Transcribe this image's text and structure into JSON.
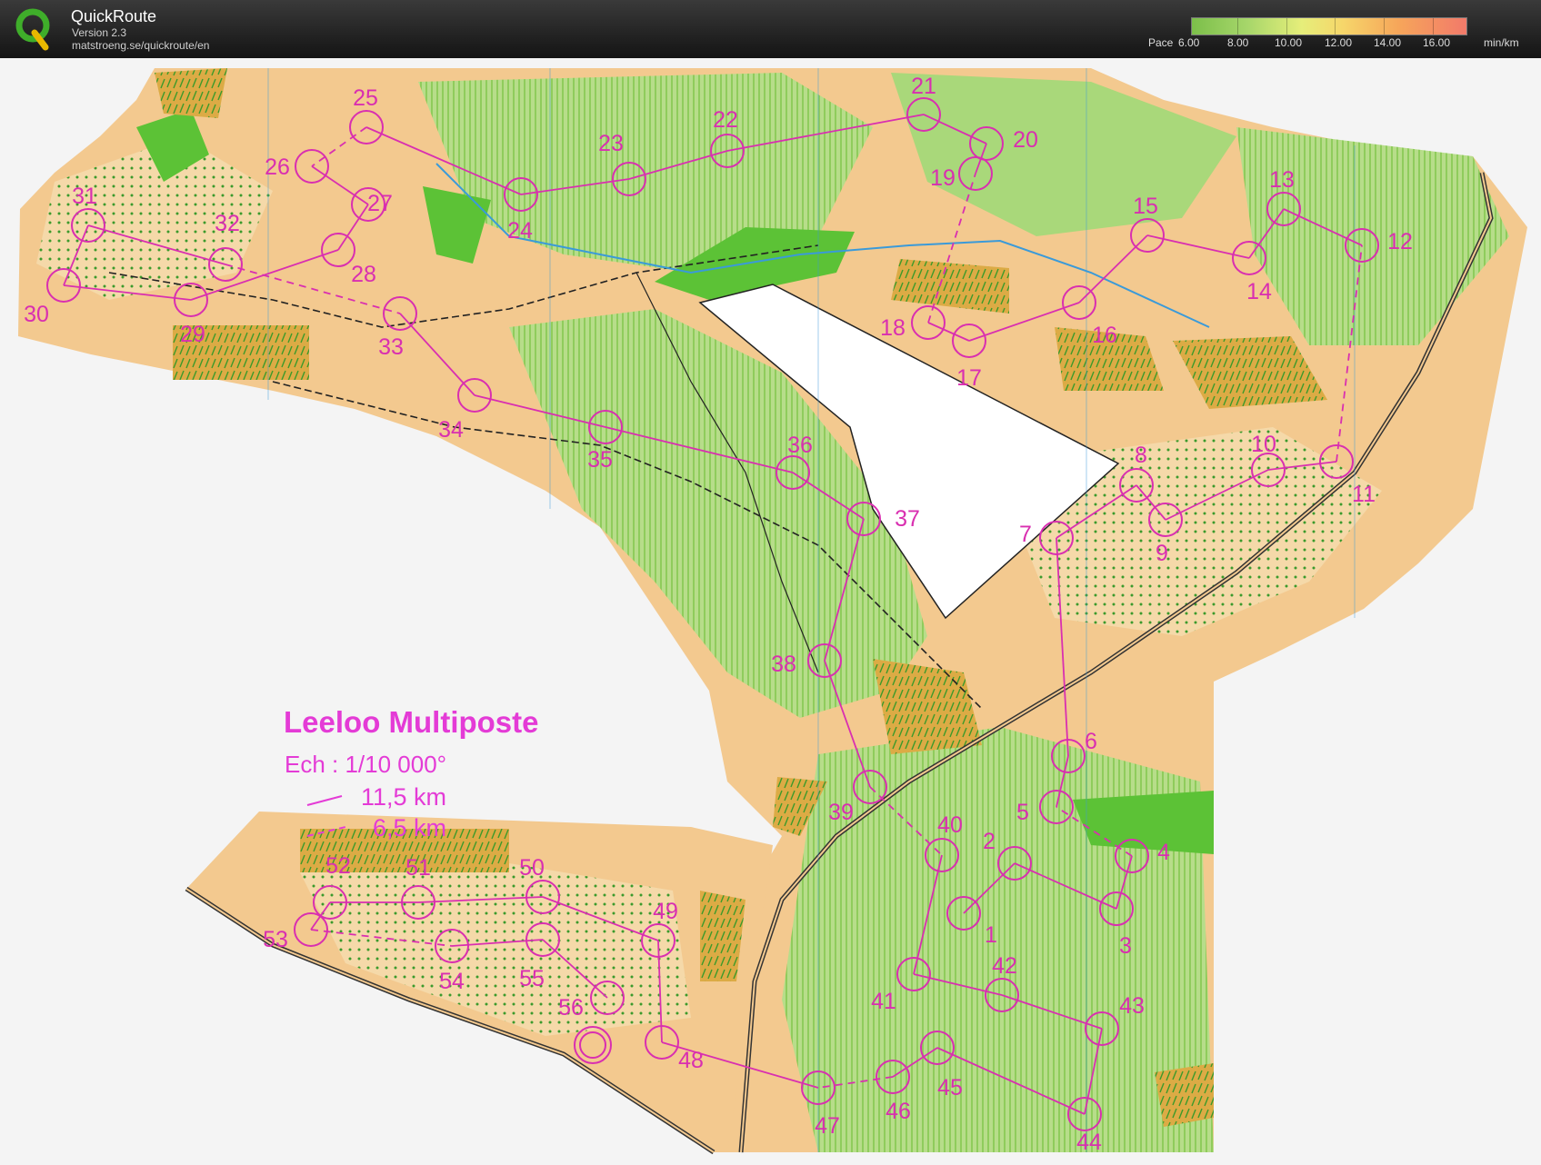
{
  "app": {
    "name": "QuickRoute",
    "version": "Version 2.3",
    "url": "matstroeng.se/quickroute/en"
  },
  "pace_legend": {
    "label": "Pace",
    "ticks": [
      "6.00",
      "8.00",
      "10.00",
      "12.00",
      "14.00",
      "16.00"
    ],
    "unit": "min/km",
    "colors": [
      "#7cbf4a",
      "#a6d66a",
      "#e6ee7a",
      "#f6d66a",
      "#f6a65a",
      "#f27a6a"
    ]
  },
  "map_legend": {
    "title": "Leeloo Multiposte",
    "scale": "Ech : 1/10 000°",
    "solid_course": "11,5 km",
    "dashed_course": "6,5 km"
  },
  "colors": {
    "course": "#d92fb0",
    "open_land": "#f3c98f",
    "rough_open": "#f7dcb0",
    "forest_green": "#a9d87a",
    "dense_green": "#5cc236",
    "field": "#e0a93c",
    "water_blue": "#3a9ad9"
  },
  "controls": [
    "1",
    "2",
    "3",
    "4",
    "5",
    "6",
    "7",
    "8",
    "9",
    "10",
    "11",
    "12",
    "13",
    "14",
    "15",
    "16",
    "17",
    "18",
    "19",
    "20",
    "21",
    "22",
    "23",
    "24",
    "25",
    "26",
    "27",
    "28",
    "29",
    "30",
    "31",
    "32",
    "33",
    "34",
    "35",
    "36",
    "37",
    "38",
    "39",
    "40",
    "41",
    "42",
    "43",
    "44",
    "45",
    "46",
    "47",
    "48",
    "49",
    "50",
    "51",
    "52",
    "53",
    "54",
    "55",
    "56"
  ]
}
